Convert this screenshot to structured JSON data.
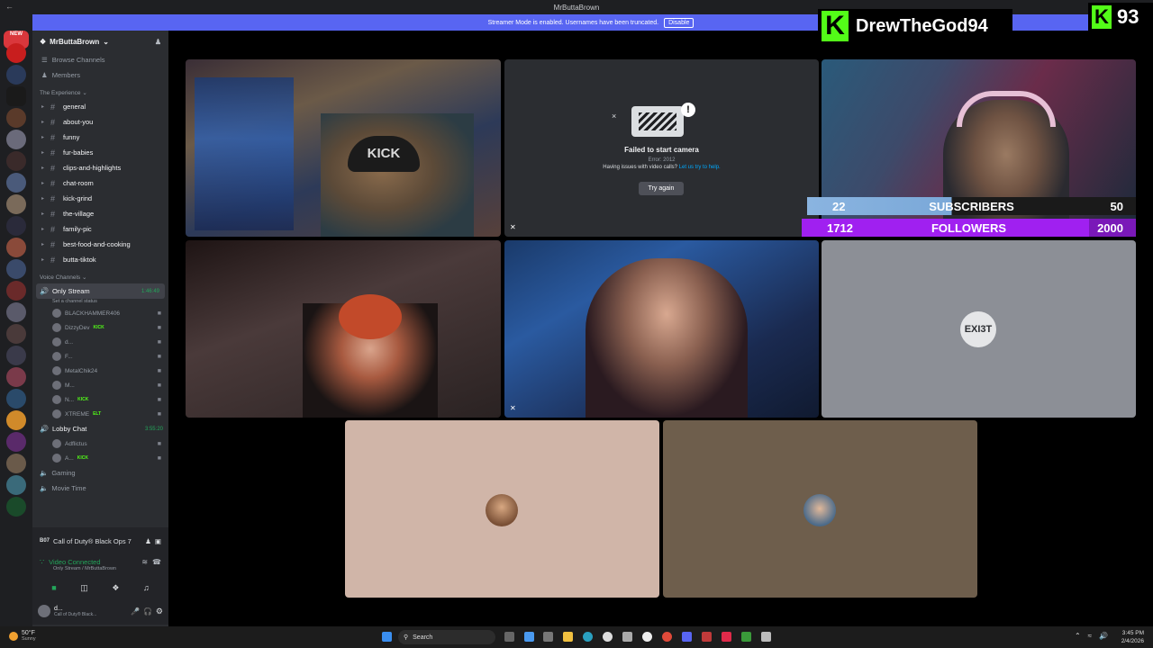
{
  "titlebar": {
    "title": "MrButtaBrown"
  },
  "streamer_bar": {
    "text": "Streamer Mode is enabled. Usernames have been truncated.",
    "button": "Disable"
  },
  "server_rail": {
    "new_badge": "NEW"
  },
  "server": {
    "name": "MrButtaBrown"
  },
  "nav": {
    "browse": "Browse Channels",
    "members": "Members"
  },
  "category_text": "The Experience",
  "text_channels": [
    {
      "name": "general"
    },
    {
      "name": "about-you"
    },
    {
      "name": "funny"
    },
    {
      "name": "fur-babies"
    },
    {
      "name": "clips-and-highlights"
    },
    {
      "name": "chat-room"
    },
    {
      "name": "kick-grind"
    },
    {
      "name": "the-village"
    },
    {
      "name": "family-pic"
    },
    {
      "name": "best-food-and-cooking"
    },
    {
      "name": "butta-tiktok"
    }
  ],
  "voice_category": "Voice Channels",
  "voice": {
    "only_stream": {
      "name": "Only Stream",
      "timer": "1:46:49",
      "status": "Set a channel status"
    },
    "only_stream_users": [
      {
        "name": "BLACKHAMMER406",
        "tag": ""
      },
      {
        "name": "DizzyDev",
        "tag": "KICK"
      },
      {
        "name": "d...",
        "tag": ""
      },
      {
        "name": "F...",
        "tag": ""
      },
      {
        "name": "MetalChik24",
        "tag": ""
      },
      {
        "name": "M...",
        "tag": ""
      },
      {
        "name": "N...",
        "tag": "KICK"
      },
      {
        "name": "XTREME",
        "tag": "ELT"
      }
    ],
    "lobby": {
      "name": "Lobby Chat",
      "timer": "3:55:20"
    },
    "lobby_users": [
      {
        "name": "Adflictus",
        "tag": ""
      },
      {
        "name": "A...",
        "tag": "KICK"
      }
    ],
    "gaming": "Gaming",
    "movie": "Movie Time"
  },
  "activity": {
    "game": "Call of Duty® Black Ops 7"
  },
  "connection": {
    "status": "Video Connected",
    "detail": "Only Stream / MrButtaBrown"
  },
  "user_panel": {
    "name": "d...",
    "status": "Call of Duty® Black..."
  },
  "camera_error": {
    "title": "Failed to start camera",
    "code": "Error: 2012",
    "help": "Having issues with video calls?",
    "help_link": "Let us try to help.",
    "button": "Try again"
  },
  "tile_exist_label": "EXI3T",
  "cam1_hat": "KICK",
  "overlay": {
    "streamer": "DrewTheGod94",
    "viewer_count": "93",
    "subscribers": {
      "current": "22",
      "label": "SUBSCRIBERS",
      "goal": "50",
      "progress": 0.44
    },
    "followers": {
      "current": "1712",
      "label": "FOLLOWERS",
      "goal": "2000",
      "progress": 0.856
    }
  },
  "taskbar": {
    "weather_temp": "50°F",
    "weather_desc": "Sunny",
    "search": "Search",
    "time": "3:45 PM",
    "date": "2/4/2026"
  }
}
